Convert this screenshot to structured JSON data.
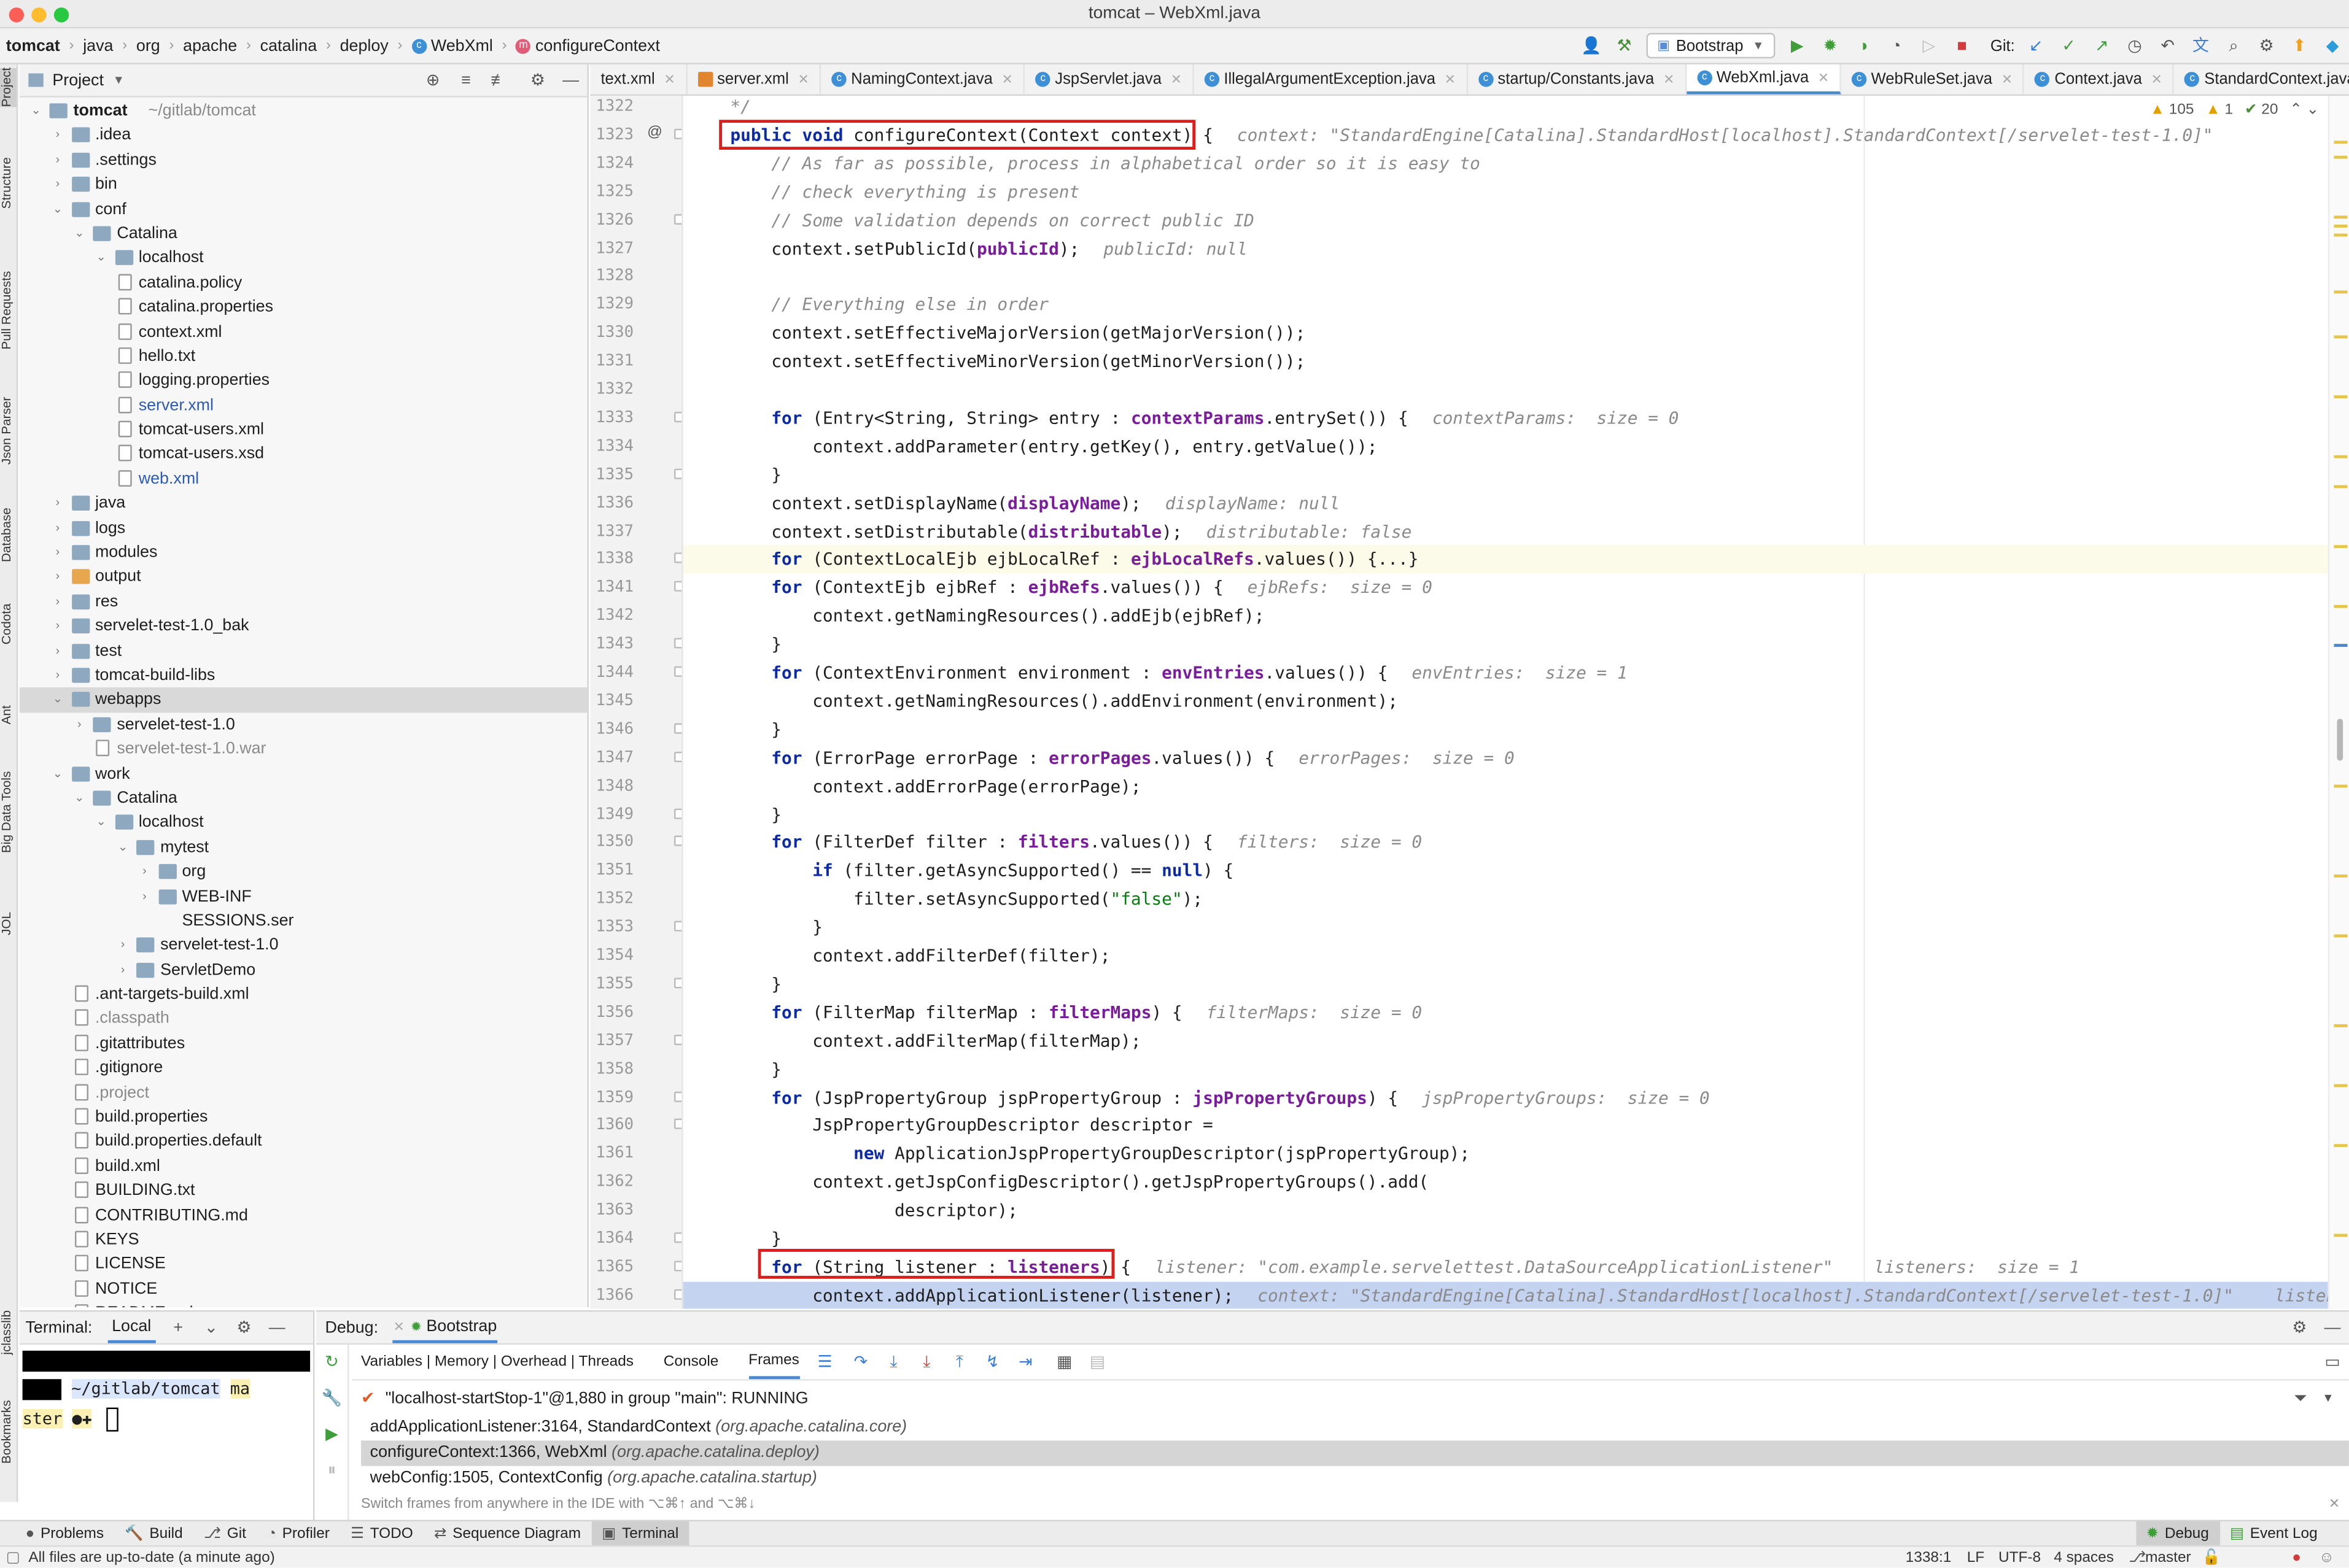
{
  "window": {
    "title": "tomcat – WebXml.java"
  },
  "breadcrumbs": [
    "tomcat",
    "java",
    "org",
    "apache",
    "catalina",
    "deploy",
    "WebXml",
    "configureContext"
  ],
  "toolbar": {
    "run_config": "Bootstrap",
    "git_label": "Git:"
  },
  "left_strip": [
    "Project",
    "Structure",
    "Pull Requests",
    "Json Parser",
    "Database",
    "Codota",
    "Ant",
    "Big Data Tools",
    "JOL",
    "jclasslib",
    "Bookmarks"
  ],
  "project": {
    "header": "Project",
    "tree": [
      {
        "label": "tomcat",
        "extra": "~/gitlab/tomcat",
        "depth": 0,
        "type": "folder",
        "open": true,
        "bold": true
      },
      {
        "label": ".idea",
        "depth": 1,
        "type": "folder",
        "open": false
      },
      {
        "label": ".settings",
        "depth": 1,
        "type": "folder",
        "open": false
      },
      {
        "label": "bin",
        "depth": 1,
        "type": "folder",
        "open": false
      },
      {
        "label": "conf",
        "depth": 1,
        "type": "folder",
        "open": true
      },
      {
        "label": "Catalina",
        "depth": 2,
        "type": "folder",
        "open": true
      },
      {
        "label": "localhost",
        "depth": 3,
        "type": "folder",
        "open": true
      },
      {
        "label": "catalina.policy",
        "depth": 3,
        "type": "file"
      },
      {
        "label": "catalina.properties",
        "depth": 3,
        "type": "file"
      },
      {
        "label": "context.xml",
        "depth": 3,
        "type": "file"
      },
      {
        "label": "hello.txt",
        "depth": 3,
        "type": "file"
      },
      {
        "label": "logging.properties",
        "depth": 3,
        "type": "file"
      },
      {
        "label": "server.xml",
        "depth": 3,
        "type": "file",
        "color": "blue"
      },
      {
        "label": "tomcat-users.xml",
        "depth": 3,
        "type": "file"
      },
      {
        "label": "tomcat-users.xsd",
        "depth": 3,
        "type": "file"
      },
      {
        "label": "web.xml",
        "depth": 3,
        "type": "file",
        "color": "blue"
      },
      {
        "label": "java",
        "depth": 1,
        "type": "folder",
        "open": false
      },
      {
        "label": "logs",
        "depth": 1,
        "type": "folder",
        "open": false
      },
      {
        "label": "modules",
        "depth": 1,
        "type": "folder",
        "open": false
      },
      {
        "label": "output",
        "depth": 1,
        "type": "folder",
        "open": false,
        "folder": "orange"
      },
      {
        "label": "res",
        "depth": 1,
        "type": "folder",
        "open": false
      },
      {
        "label": "servelet-test-1.0_bak",
        "depth": 1,
        "type": "folder",
        "open": false
      },
      {
        "label": "test",
        "depth": 1,
        "type": "folder",
        "open": false
      },
      {
        "label": "tomcat-build-libs",
        "depth": 1,
        "type": "folder",
        "open": false
      },
      {
        "label": "webapps",
        "depth": 1,
        "type": "folder",
        "open": true,
        "selected": true
      },
      {
        "label": "servelet-test-1.0",
        "depth": 2,
        "type": "folder",
        "open": false
      },
      {
        "label": "servelet-test-1.0.war",
        "depth": 2,
        "type": "file",
        "color": "gray"
      },
      {
        "label": "work",
        "depth": 1,
        "type": "folder",
        "open": true
      },
      {
        "label": "Catalina",
        "depth": 2,
        "type": "folder",
        "open": true
      },
      {
        "label": "localhost",
        "depth": 3,
        "type": "folder",
        "open": true
      },
      {
        "label": "mytest",
        "depth": 4,
        "type": "folder",
        "open": true
      },
      {
        "label": "org",
        "depth": 5,
        "type": "folder",
        "open": false
      },
      {
        "label": "WEB-INF",
        "depth": 5,
        "type": "folder",
        "open": false
      },
      {
        "label": "SESSIONS.ser",
        "depth": 5,
        "type": "file",
        "noicon": true
      },
      {
        "label": "servelet-test-1.0",
        "depth": 4,
        "type": "folder",
        "open": false
      },
      {
        "label": "ServletDemo",
        "depth": 4,
        "type": "folder",
        "open": false
      },
      {
        "label": ".ant-targets-build.xml",
        "depth": 1,
        "type": "file"
      },
      {
        "label": ".classpath",
        "depth": 1,
        "type": "file",
        "color": "gray"
      },
      {
        "label": ".gitattributes",
        "depth": 1,
        "type": "file"
      },
      {
        "label": ".gitignore",
        "depth": 1,
        "type": "file"
      },
      {
        "label": ".project",
        "depth": 1,
        "type": "file",
        "color": "gray"
      },
      {
        "label": "build.properties",
        "depth": 1,
        "type": "file"
      },
      {
        "label": "build.properties.default",
        "depth": 1,
        "type": "file"
      },
      {
        "label": "build.xml",
        "depth": 1,
        "type": "file"
      },
      {
        "label": "BUILDING.txt",
        "depth": 1,
        "type": "file"
      },
      {
        "label": "CONTRIBUTING.md",
        "depth": 1,
        "type": "file"
      },
      {
        "label": "KEYS",
        "depth": 1,
        "type": "file"
      },
      {
        "label": "LICENSE",
        "depth": 1,
        "type": "file"
      },
      {
        "label": "NOTICE",
        "depth": 1,
        "type": "file"
      },
      {
        "label": "README.md",
        "depth": 1,
        "type": "file"
      }
    ]
  },
  "editor": {
    "tabs": [
      {
        "label": "text.xml",
        "active": false
      },
      {
        "label": "server.xml",
        "active": false
      },
      {
        "label": "NamingContext.java",
        "active": false
      },
      {
        "label": "JspServlet.java",
        "active": false
      },
      {
        "label": "IllegalArgumentException.java",
        "active": false
      },
      {
        "label": "startup/Constants.java",
        "active": false
      },
      {
        "label": "WebXml.java",
        "active": true
      },
      {
        "label": "WebRuleSet.java",
        "active": false
      },
      {
        "label": "Context.java",
        "active": false
      },
      {
        "label": "StandardContext.java",
        "active": false
      }
    ],
    "inspections": {
      "warnings": "105",
      "weak": "1",
      "typos": "20"
    },
    "lines": [
      {
        "n": "1322",
        "t": "    */",
        "cls": "cm"
      },
      {
        "n": "1323",
        "t": "    public void configureContext(Context context) {",
        "hint": "context: \"StandardEngine[Catalina].StandardHost[localhost].StandardContext[/servelet-test-1.0]\""
      },
      {
        "n": "1324",
        "t": "        // As far as possible, process in alphabetical order so it is easy to",
        "cls": "cm"
      },
      {
        "n": "1325",
        "t": "        // check everything is present",
        "cls": "cm"
      },
      {
        "n": "1326",
        "t": "        // Some validation depends on correct public ID",
        "cls": "cm"
      },
      {
        "n": "1327",
        "t": "        context.setPublicId(publicId);",
        "hint": "publicId: null"
      },
      {
        "n": "1328",
        "t": ""
      },
      {
        "n": "1329",
        "t": "        // Everything else in order",
        "cls": "cm"
      },
      {
        "n": "1330",
        "t": "        context.setEffectiveMajorVersion(getMajorVersion());"
      },
      {
        "n": "1331",
        "t": "        context.setEffectiveMinorVersion(getMinorVersion());"
      },
      {
        "n": "1332",
        "t": ""
      },
      {
        "n": "1333",
        "t": "        for (Entry<String, String> entry : contextParams.entrySet()) {",
        "hint": "contextParams:  size = 0"
      },
      {
        "n": "1334",
        "t": "            context.addParameter(entry.getKey(), entry.getValue());"
      },
      {
        "n": "1335",
        "t": "        }"
      },
      {
        "n": "1336",
        "t": "        context.setDisplayName(displayName);",
        "hint": "displayName: null"
      },
      {
        "n": "1337",
        "t": "        context.setDistributable(distributable);",
        "hint": "distributable: false"
      },
      {
        "n": "1338",
        "t": "        for (ContextLocalEjb ejbLocalRef : ejbLocalRefs.values()) {...}",
        "state": "cur"
      },
      {
        "n": "1341",
        "t": "        for (ContextEjb ejbRef : ejbRefs.values()) {",
        "hint": "ejbRefs:  size = 0"
      },
      {
        "n": "1342",
        "t": "            context.getNamingResources().addEjb(ejbRef);"
      },
      {
        "n": "1343",
        "t": "        }"
      },
      {
        "n": "1344",
        "t": "        for (ContextEnvironment environment : envEntries.values()) {",
        "hint": "envEntries:  size = 1"
      },
      {
        "n": "1345",
        "t": "            context.getNamingResources().addEnvironment(environment);"
      },
      {
        "n": "1346",
        "t": "        }"
      },
      {
        "n": "1347",
        "t": "        for (ErrorPage errorPage : errorPages.values()) {",
        "hint": "errorPages:  size = 0"
      },
      {
        "n": "1348",
        "t": "            context.addErrorPage(errorPage);"
      },
      {
        "n": "1349",
        "t": "        }"
      },
      {
        "n": "1350",
        "t": "        for (FilterDef filter : filters.values()) {",
        "hint": "filters:  size = 0"
      },
      {
        "n": "1351",
        "t": "            if (filter.getAsyncSupported() == null) {"
      },
      {
        "n": "1352",
        "t": "                filter.setAsyncSupported(\"false\");"
      },
      {
        "n": "1353",
        "t": "            }"
      },
      {
        "n": "1354",
        "t": "            context.addFilterDef(filter);"
      },
      {
        "n": "1355",
        "t": "        }"
      },
      {
        "n": "1356",
        "t": "        for (FilterMap filterMap : filterMaps) {",
        "hint": "filterMaps:  size = 0"
      },
      {
        "n": "1357",
        "t": "            context.addFilterMap(filterMap);"
      },
      {
        "n": "1358",
        "t": "        }"
      },
      {
        "n": "1359",
        "t": "        for (JspPropertyGroup jspPropertyGroup : jspPropertyGroups) {",
        "hint": "jspPropertyGroups:  size = 0"
      },
      {
        "n": "1360",
        "t": "            JspPropertyGroupDescriptor descriptor ="
      },
      {
        "n": "1361",
        "t": "                new ApplicationJspPropertyGroupDescriptor(jspPropertyGroup);"
      },
      {
        "n": "1362",
        "t": "            context.getJspConfigDescriptor().getJspPropertyGroups().add("
      },
      {
        "n": "1363",
        "t": "                    descriptor);"
      },
      {
        "n": "1364",
        "t": "        }"
      },
      {
        "n": "1365",
        "t": "        for (String listener : listeners) {",
        "hint": "listener: \"com.example.servelettest.DataSourceApplicationListener\"    listeners:  size = 1"
      },
      {
        "n": "1366",
        "t": "            context.addApplicationListener(listener);",
        "hint": "context: \"StandardEngine[Catalina].StandardHost[localhost].StandardContext[/servelet-test-1.0]\"    listener: \"com.",
        "state": "exec"
      }
    ]
  },
  "terminal": {
    "title": "Terminal:",
    "tab": "Local",
    "prompt_path": "~/gitlab/tomcat",
    "prompt_branch1": "ma",
    "prompt_branch2": "ster"
  },
  "debug": {
    "title": "Debug:",
    "session": "Bootstrap",
    "tabs": [
      "Variables | Memory | Overhead | Threads",
      "Console",
      "Frames"
    ],
    "thread": "\"localhost-startStop-1\"@1,880 in group \"main\": RUNNING",
    "frames": [
      {
        "method": "addApplicationListener:3164, StandardContext",
        "pkg": "(org.apache.catalina.core)",
        "selected": false
      },
      {
        "method": "configureContext:1366, WebXml",
        "pkg": "(org.apache.catalina.deploy)",
        "selected": true
      },
      {
        "method": "webConfig:1505, ContextConfig",
        "pkg": "(org.apache.catalina.startup)",
        "selected": false
      }
    ],
    "tip": "Switch frames from anywhere in the IDE with ⌥⌘↑ and ⌥⌘↓"
  },
  "bottom_tools": [
    {
      "label": "Problems",
      "icon": "●"
    },
    {
      "label": "Build",
      "icon": "🔨"
    },
    {
      "label": "Git",
      "icon": "⎇"
    },
    {
      "label": "Profiler",
      "icon": "◔"
    },
    {
      "label": "TODO",
      "icon": "☰"
    },
    {
      "label": "Sequence Diagram",
      "icon": "⇄"
    },
    {
      "label": "Terminal",
      "icon": "▣",
      "active": true
    }
  ],
  "right_tools": [
    {
      "label": "Debug",
      "active": true
    },
    {
      "label": "Event Log",
      "active": false
    }
  ],
  "status": {
    "message": "All files are up-to-date (a minute ago)",
    "position": "1338:1",
    "eol": "LF",
    "encoding": "UTF-8",
    "indent": "4 spaces",
    "branch": "master"
  }
}
